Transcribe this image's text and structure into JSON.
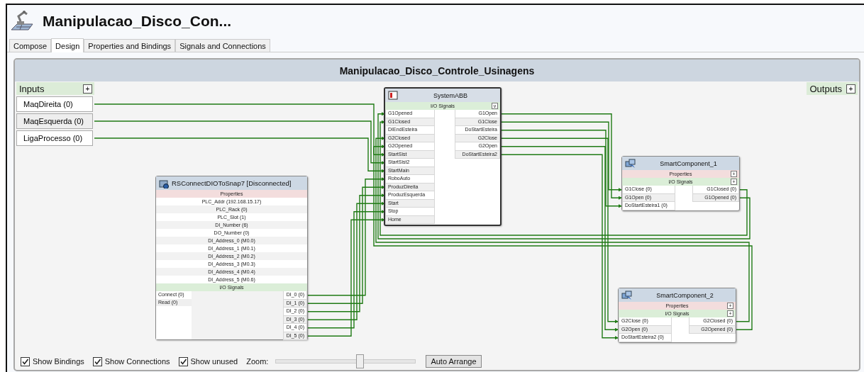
{
  "window": {
    "title": "Manipulacao_Disco_Con..."
  },
  "tabs": [
    {
      "label": "Compose",
      "selected": false
    },
    {
      "label": "Design",
      "selected": true
    },
    {
      "label": "Properties and Bindings",
      "selected": false
    },
    {
      "label": "Signals and Connections",
      "selected": false
    }
  ],
  "canvas": {
    "title": "Manipulacao_Disco_Controle_Usinagens",
    "inputs": {
      "label": "Inputs",
      "add_button": "+",
      "items": [
        "MaqDireita (0)",
        "MaqEsquerda (0)",
        "LigaProcesso (0)"
      ]
    },
    "outputs": {
      "label": "Outputs",
      "add_button": "+"
    },
    "components": [
      {
        "kind": "controller",
        "title": "SystemABB",
        "signals": {
          "label": "I/O Signals",
          "toggle": "v",
          "inputs": [
            "G1Opened",
            "G1Closed",
            "DIEndEsteira",
            "G2Closed",
            "G2Opened",
            "StartSist",
            "StartSist2",
            "StartMain",
            "RoboAuto",
            "ProduzDireita",
            "ProduzEsquerda",
            "Start",
            "Stop",
            "Home"
          ],
          "outputs": [
            "G1Open",
            "G1Close",
            "DoStartEsteira",
            "G2Close",
            "G2Open",
            "DoStartEsteira2"
          ]
        }
      },
      {
        "kind": "rsconnect",
        "title": "RSConnectDIOToSnap7 [Disconnected]",
        "properties": {
          "label": "Properties",
          "items": [
            "PLC_Addr (192.168.15.17)",
            "PLC_Rack (0)",
            "PLC_Slot (1)",
            "DI_Number (6)",
            "DO_Number (0)",
            "DI_Address_0 (M0.0)",
            "DI_Address_1 (M0.1)",
            "DI_Address_2 (M0.2)",
            "DI_Address_3 (M0.3)",
            "DI_Address_4 (M0.4)",
            "DI_Address_5 (M0.6)"
          ]
        },
        "signals": {
          "label": "I/O Signals",
          "inputs": [
            "Connect (0)",
            "Read (0)"
          ],
          "outputs": [
            "DI_0 (0)",
            "DI_1 (0)",
            "DI_2 (0)",
            "DI_3 (0)",
            "DI_4 (0)",
            "DI_5 (0)"
          ]
        }
      },
      {
        "kind": "smart",
        "title": "SmartComponent_1",
        "properties": {
          "label": "Properties",
          "toggle": "+"
        },
        "signals": {
          "label": "I/O Signals",
          "toggle": "+",
          "inputs": [
            "G1Close (0)",
            "G1Open (0)",
            "DoStartEsteira1 (0)"
          ],
          "outputs": [
            "G1Closed (0)",
            "G1Opened (0)"
          ]
        }
      },
      {
        "kind": "smart",
        "title": "SmartComponent_2",
        "properties": {
          "label": "Properties",
          "toggle": "+"
        },
        "signals": {
          "label": "I/O Signals",
          "toggle": "+",
          "inputs": [
            "G2Close (0)",
            "G2Open (0)",
            "DoStartEsteira2 (0)"
          ],
          "outputs": [
            "G2Closed (0)",
            "G2Opened (0)"
          ]
        }
      }
    ]
  },
  "bottom_bar": {
    "options": [
      {
        "label": "Show Bindings",
        "checked": true
      },
      {
        "label": "Show Connections",
        "checked": true
      },
      {
        "label": "Show unused",
        "checked": true
      }
    ],
    "zoom": {
      "label": "Zoom:",
      "level": 0.6
    },
    "button": "Auto Arrange"
  }
}
